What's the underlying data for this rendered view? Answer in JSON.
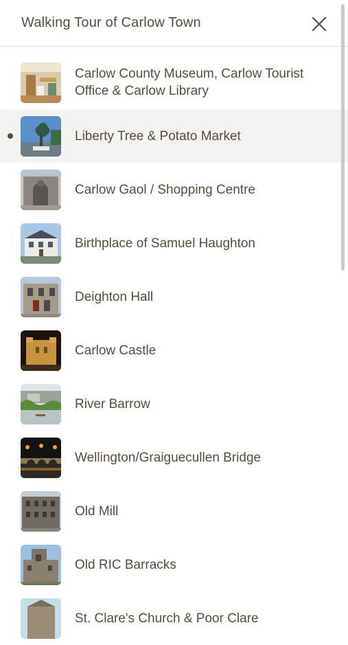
{
  "header": {
    "title": "Walking Tour of Carlow Town",
    "close_icon": "close-icon"
  },
  "stops": [
    {
      "label": "Carlow County Museum, Carlow Tourist Office & Carlow Library",
      "thumb": "museum-interior",
      "active": false
    },
    {
      "label": "Liberty Tree & Potato Market",
      "thumb": "liberty-tree",
      "active": true
    },
    {
      "label": "Carlow Gaol / Shopping Centre",
      "thumb": "gaol",
      "active": false
    },
    {
      "label": "Birthplace of Samuel Haughton",
      "thumb": "house",
      "active": false
    },
    {
      "label": "Deighton Hall",
      "thumb": "hall",
      "active": false
    },
    {
      "label": "Carlow Castle",
      "thumb": "castle-night",
      "active": false
    },
    {
      "label": "River Barrow",
      "thumb": "river",
      "active": false
    },
    {
      "label": "Wellington/Graiguecullen Bridge",
      "thumb": "bridge-night",
      "active": false
    },
    {
      "label": "Old Mill",
      "thumb": "mill",
      "active": false
    },
    {
      "label": "Old RIC Barracks",
      "thumb": "barracks",
      "active": false
    },
    {
      "label": "St. Clare's Church & Poor Clare",
      "thumb": "church",
      "active": false
    }
  ],
  "colors": {
    "text": "#5a4b3c",
    "active_bg": "#f3f3f2",
    "divider": "#e6e2dd"
  }
}
